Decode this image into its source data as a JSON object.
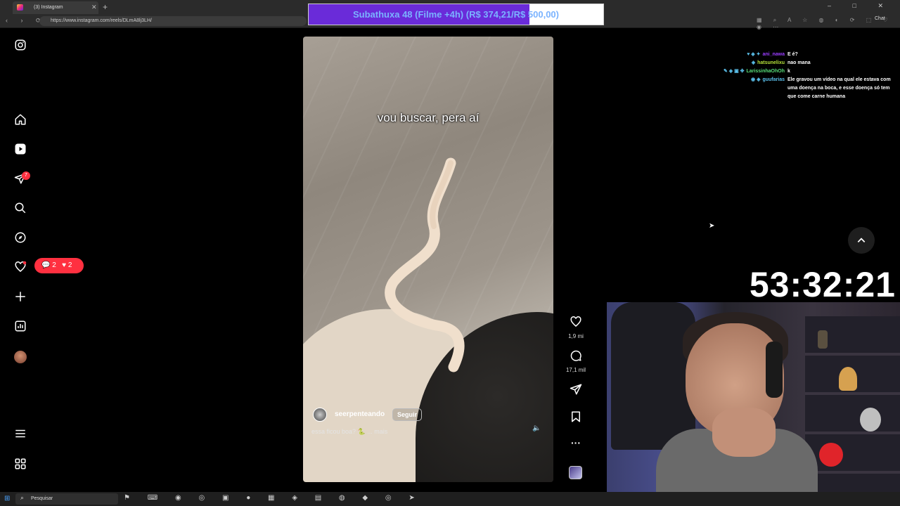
{
  "browser": {
    "tab_title": "(3) Instagram",
    "url": "https://www.instagram.com/reels/DLmA8lj3LH/",
    "nav_icons": "‹ › ⟳ ⌂",
    "tool_icons": "▦ ⌕ A ☆ ◍ ◐ ⟳ ⬚ ♡ ◉ ⋯",
    "chat_button": "Chat",
    "window_buttons": "– □ ✕"
  },
  "banner": {
    "text": "Subathuxa 48 (Filme +4h) (R$ 374,21/R$ 500,00)",
    "progress": 0.7484,
    "fill_color": "#6a2bd9"
  },
  "sidebar": {
    "icons": [
      "instagram-logo-icon",
      "home-icon",
      "reels-icon",
      "messages-icon",
      "search-icon",
      "explore-icon",
      "notifications-icon",
      "create-icon",
      "dashboard-icon",
      "profile-icon",
      "more-icon",
      "also-from-meta-icon"
    ],
    "messages_badge": "7",
    "notif_comments": "2",
    "notif_likes": "2"
  },
  "reel": {
    "caption_overlay": "vou buscar, pera aí",
    "username": "seerpenteando",
    "follow_label": "Seguir",
    "description": "essa ficou boa? 🐍 ... mais",
    "likes": "1,9 mi",
    "comments": "17,1 mil"
  },
  "chat": {
    "messages": [
      {
        "user": "ani_nawa",
        "user_color": "#9b3dff",
        "badges": "♥ ◈ ✦",
        "text": "E é?"
      },
      {
        "user": "hatsunelixu",
        "user_color": "#b6e13a",
        "badges": "◈",
        "text": "nao mana"
      },
      {
        "user": "LarissinhaOhOh",
        "user_color": "#58e07a",
        "badges": "✎ ◈ ▣ ✤",
        "text": "k"
      },
      {
        "user": "guufarias",
        "user_color": "#5bc0eb",
        "badges": "◉ ◈",
        "text": "Ele gravou um vídeo na qual ele estava com uma doença na boca, e esse doença só tem que come carne humana"
      }
    ]
  },
  "stream": {
    "timer": "53:32:21"
  },
  "taskbar": {
    "search_placeholder": "Pesquisar",
    "icons": "⚑ ⌨ ◉ ◎ ▣ ● ▦ ◈ ▤ ◍ ◆ ◎ ➤"
  }
}
